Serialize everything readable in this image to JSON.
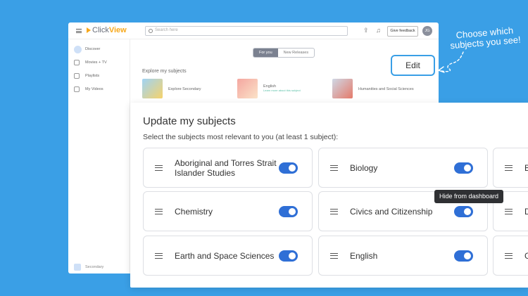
{
  "app": {
    "logo_click": "Click",
    "logo_view": "View",
    "search_placeholder": "Search here",
    "give_feedback": "Give feedback",
    "avatar_initials": "JG",
    "sidebar": [
      "Discover",
      "Movies + TV",
      "Playlists",
      "My Videos"
    ],
    "sidebar_bottom": "Secondary",
    "tabs": [
      "For you",
      "New Releases"
    ],
    "explore_title": "Explore my subjects",
    "tiles": [
      {
        "label": "Explore Secondary",
        "sub": ""
      },
      {
        "label": "English",
        "sub": "Learn more about this subject"
      },
      {
        "label": "Humanities and Social Sciences",
        "sub": ""
      }
    ]
  },
  "callout": {
    "edit": "Edit",
    "line1": "Choose which",
    "line2": "subjects you see!"
  },
  "modal": {
    "title": "Update my subjects",
    "subtitle": "Select the subjects most relevant to you (at least 1 subject):",
    "subjects": [
      {
        "label": "Aboriginal and Torres Strait Islander Studies",
        "enabled": true
      },
      {
        "label": "Biology",
        "enabled": true
      },
      {
        "label": "B",
        "enabled": true
      },
      {
        "label": "Chemistry",
        "enabled": true
      },
      {
        "label": "Civics and Citizenship",
        "enabled": true
      },
      {
        "label": "D",
        "enabled": true
      },
      {
        "label": "Earth and Space Sciences",
        "enabled": true
      },
      {
        "label": "English",
        "enabled": true
      },
      {
        "label": "G",
        "enabled": true
      }
    ],
    "tooltip": "Hide from dashboard"
  },
  "colors": {
    "background": "#3a9fe6",
    "toggle_on": "#2f6fd6",
    "logo_accent": "#f7a81b"
  }
}
